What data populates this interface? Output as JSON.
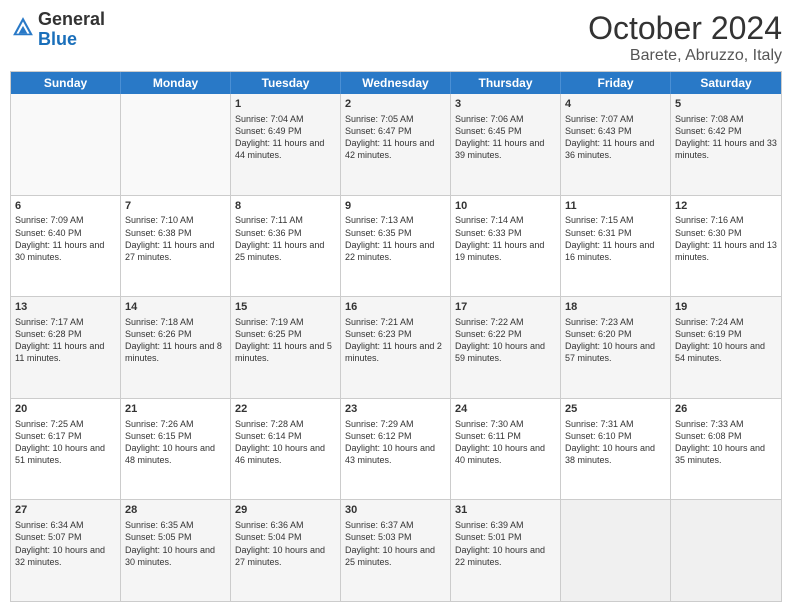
{
  "header": {
    "logo_general": "General",
    "logo_blue": "Blue",
    "month": "October 2024",
    "location": "Barete, Abruzzo, Italy"
  },
  "days_of_week": [
    "Sunday",
    "Monday",
    "Tuesday",
    "Wednesday",
    "Thursday",
    "Friday",
    "Saturday"
  ],
  "weeks": [
    [
      {
        "day": "",
        "empty": true
      },
      {
        "day": "",
        "empty": true
      },
      {
        "day": "1",
        "sunrise": "Sunrise: 7:04 AM",
        "sunset": "Sunset: 6:49 PM",
        "daylight": "Daylight: 11 hours and 44 minutes."
      },
      {
        "day": "2",
        "sunrise": "Sunrise: 7:05 AM",
        "sunset": "Sunset: 6:47 PM",
        "daylight": "Daylight: 11 hours and 42 minutes."
      },
      {
        "day": "3",
        "sunrise": "Sunrise: 7:06 AM",
        "sunset": "Sunset: 6:45 PM",
        "daylight": "Daylight: 11 hours and 39 minutes."
      },
      {
        "day": "4",
        "sunrise": "Sunrise: 7:07 AM",
        "sunset": "Sunset: 6:43 PM",
        "daylight": "Daylight: 11 hours and 36 minutes."
      },
      {
        "day": "5",
        "sunrise": "Sunrise: 7:08 AM",
        "sunset": "Sunset: 6:42 PM",
        "daylight": "Daylight: 11 hours and 33 minutes."
      }
    ],
    [
      {
        "day": "6",
        "sunrise": "Sunrise: 7:09 AM",
        "sunset": "Sunset: 6:40 PM",
        "daylight": "Daylight: 11 hours and 30 minutes."
      },
      {
        "day": "7",
        "sunrise": "Sunrise: 7:10 AM",
        "sunset": "Sunset: 6:38 PM",
        "daylight": "Daylight: 11 hours and 27 minutes."
      },
      {
        "day": "8",
        "sunrise": "Sunrise: 7:11 AM",
        "sunset": "Sunset: 6:36 PM",
        "daylight": "Daylight: 11 hours and 25 minutes."
      },
      {
        "day": "9",
        "sunrise": "Sunrise: 7:13 AM",
        "sunset": "Sunset: 6:35 PM",
        "daylight": "Daylight: 11 hours and 22 minutes."
      },
      {
        "day": "10",
        "sunrise": "Sunrise: 7:14 AM",
        "sunset": "Sunset: 6:33 PM",
        "daylight": "Daylight: 11 hours and 19 minutes."
      },
      {
        "day": "11",
        "sunrise": "Sunrise: 7:15 AM",
        "sunset": "Sunset: 6:31 PM",
        "daylight": "Daylight: 11 hours and 16 minutes."
      },
      {
        "day": "12",
        "sunrise": "Sunrise: 7:16 AM",
        "sunset": "Sunset: 6:30 PM",
        "daylight": "Daylight: 11 hours and 13 minutes."
      }
    ],
    [
      {
        "day": "13",
        "sunrise": "Sunrise: 7:17 AM",
        "sunset": "Sunset: 6:28 PM",
        "daylight": "Daylight: 11 hours and 11 minutes."
      },
      {
        "day": "14",
        "sunrise": "Sunrise: 7:18 AM",
        "sunset": "Sunset: 6:26 PM",
        "daylight": "Daylight: 11 hours and 8 minutes."
      },
      {
        "day": "15",
        "sunrise": "Sunrise: 7:19 AM",
        "sunset": "Sunset: 6:25 PM",
        "daylight": "Daylight: 11 hours and 5 minutes."
      },
      {
        "day": "16",
        "sunrise": "Sunrise: 7:21 AM",
        "sunset": "Sunset: 6:23 PM",
        "daylight": "Daylight: 11 hours and 2 minutes."
      },
      {
        "day": "17",
        "sunrise": "Sunrise: 7:22 AM",
        "sunset": "Sunset: 6:22 PM",
        "daylight": "Daylight: 10 hours and 59 minutes."
      },
      {
        "day": "18",
        "sunrise": "Sunrise: 7:23 AM",
        "sunset": "Sunset: 6:20 PM",
        "daylight": "Daylight: 10 hours and 57 minutes."
      },
      {
        "day": "19",
        "sunrise": "Sunrise: 7:24 AM",
        "sunset": "Sunset: 6:19 PM",
        "daylight": "Daylight: 10 hours and 54 minutes."
      }
    ],
    [
      {
        "day": "20",
        "sunrise": "Sunrise: 7:25 AM",
        "sunset": "Sunset: 6:17 PM",
        "daylight": "Daylight: 10 hours and 51 minutes."
      },
      {
        "day": "21",
        "sunrise": "Sunrise: 7:26 AM",
        "sunset": "Sunset: 6:15 PM",
        "daylight": "Daylight: 10 hours and 48 minutes."
      },
      {
        "day": "22",
        "sunrise": "Sunrise: 7:28 AM",
        "sunset": "Sunset: 6:14 PM",
        "daylight": "Daylight: 10 hours and 46 minutes."
      },
      {
        "day": "23",
        "sunrise": "Sunrise: 7:29 AM",
        "sunset": "Sunset: 6:12 PM",
        "daylight": "Daylight: 10 hours and 43 minutes."
      },
      {
        "day": "24",
        "sunrise": "Sunrise: 7:30 AM",
        "sunset": "Sunset: 6:11 PM",
        "daylight": "Daylight: 10 hours and 40 minutes."
      },
      {
        "day": "25",
        "sunrise": "Sunrise: 7:31 AM",
        "sunset": "Sunset: 6:10 PM",
        "daylight": "Daylight: 10 hours and 38 minutes."
      },
      {
        "day": "26",
        "sunrise": "Sunrise: 7:33 AM",
        "sunset": "Sunset: 6:08 PM",
        "daylight": "Daylight: 10 hours and 35 minutes."
      }
    ],
    [
      {
        "day": "27",
        "sunrise": "Sunrise: 6:34 AM",
        "sunset": "Sunset: 5:07 PM",
        "daylight": "Daylight: 10 hours and 32 minutes."
      },
      {
        "day": "28",
        "sunrise": "Sunrise: 6:35 AM",
        "sunset": "Sunset: 5:05 PM",
        "daylight": "Daylight: 10 hours and 30 minutes."
      },
      {
        "day": "29",
        "sunrise": "Sunrise: 6:36 AM",
        "sunset": "Sunset: 5:04 PM",
        "daylight": "Daylight: 10 hours and 27 minutes."
      },
      {
        "day": "30",
        "sunrise": "Sunrise: 6:37 AM",
        "sunset": "Sunset: 5:03 PM",
        "daylight": "Daylight: 10 hours and 25 minutes."
      },
      {
        "day": "31",
        "sunrise": "Sunrise: 6:39 AM",
        "sunset": "Sunset: 5:01 PM",
        "daylight": "Daylight: 10 hours and 22 minutes."
      },
      {
        "day": "",
        "empty": true
      },
      {
        "day": "",
        "empty": true
      }
    ]
  ]
}
